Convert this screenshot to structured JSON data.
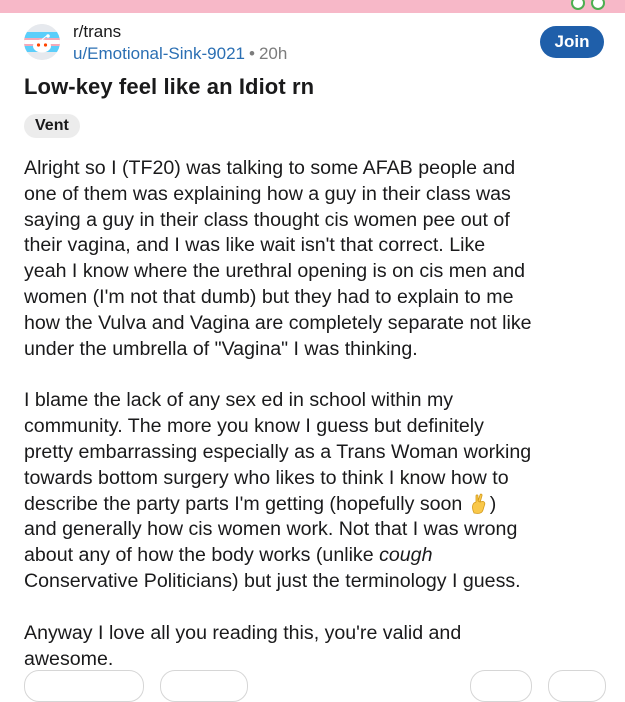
{
  "post": {
    "subreddit": "r/trans",
    "author": "u/Emotional-Sink-9021",
    "separator": "•",
    "age": "20h",
    "join_label": "Join",
    "title": "Low-key feel like an Idiot rn",
    "flair": "Vent",
    "body": {
      "p1": "Alright so I (TF20) was talking to some AFAB people and\none of them was explaining how a guy in their class was\nsaying a guy in their class thought cis women pee out of\ntheir vagina, and I was like wait isn't that correct. Like\nyeah I know where the urethral opening is on cis men and\nwomen (I'm not that dumb) but they had to explain to me\nhow the Vulva and Vagina are completely separate not like\nunder the umbrella of \"Vagina\" I was thinking.",
      "p2_a": "I blame the lack of any sex ed in school within my\ncommunity. The more you know I guess but definitely\npretty embarrassing especially as a Trans Woman working\ntowards bottom surgery who likes to think I know how to\ndescribe the party parts I'm getting (hopefully soon ",
      "p2_emoji": "crossed-fingers-icon",
      "p2_b": ")\nand generally how cis women work. Not that I was wrong\nabout any of how the body works (unlike ",
      "p2_italic": "cough",
      "p2_c": "\nConservative Politicians) but just the terminology I guess.",
      "p3": "Anyway I love all you reading this, you're valid and\nawesome."
    }
  },
  "colors": {
    "accent": "#1f5faa",
    "link": "#2b6fb3",
    "muted": "#7c7c7c",
    "top_strip": "#f7b8c8"
  }
}
